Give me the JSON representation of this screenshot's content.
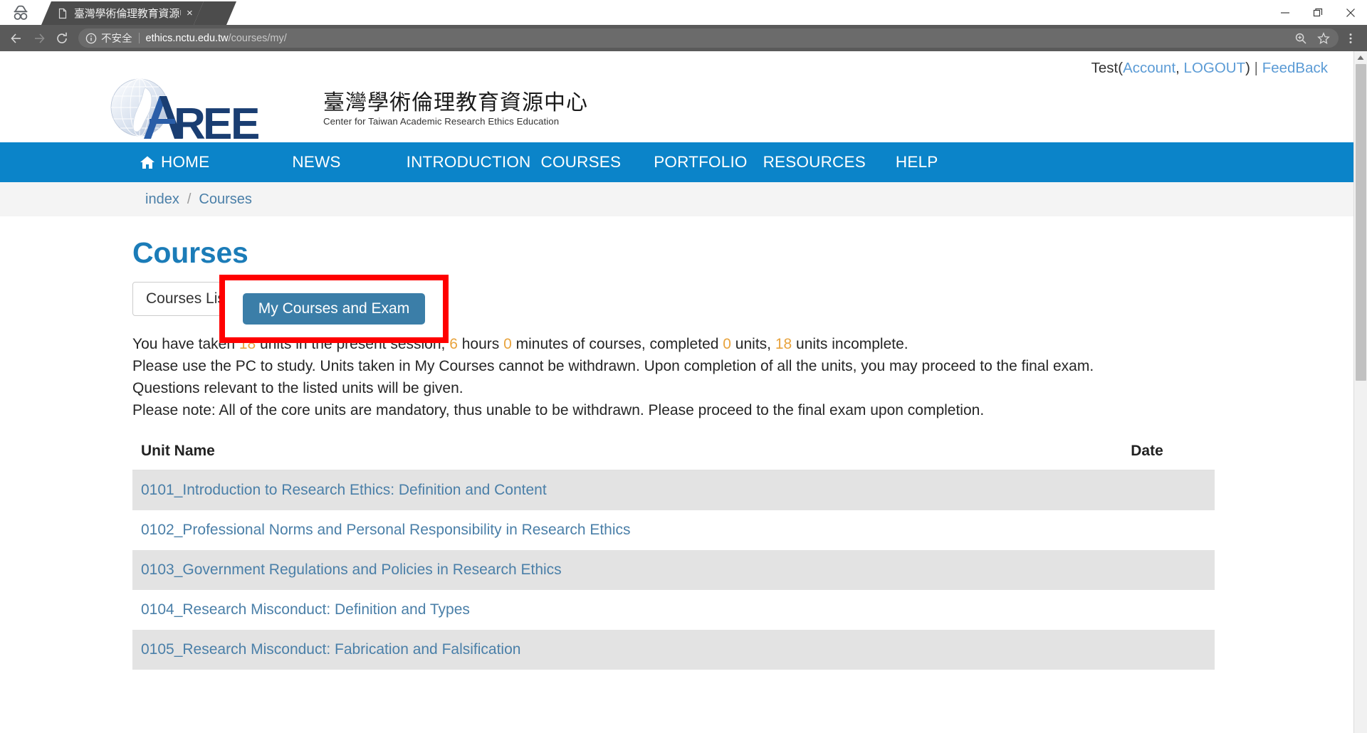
{
  "browser": {
    "incognito_icon": "incognito-icon",
    "tab": {
      "title": "臺灣學術倫理教育資源中",
      "favicon": "document-icon",
      "close": "×"
    },
    "nav": {
      "back": "back-arrow-icon",
      "forward": "forward-arrow-icon",
      "reload": "reload-icon"
    },
    "omnibox": {
      "info_icon": "info-circle-icon",
      "security_label": "不安全",
      "url_host": "ethics.nctu.edu.tw",
      "url_path": "/courses/my/",
      "zoom_icon": "zoom-search-icon",
      "bookmark_icon": "star-icon"
    },
    "menu_icon": "kebab-menu-icon",
    "window_controls": {
      "minimize": "minimize-icon",
      "maximize": "restore-icon",
      "close": "close-icon"
    }
  },
  "site": {
    "userbar": {
      "username": "Test",
      "open_paren": "(",
      "account_link": "Account",
      "comma": ", ",
      "logout_link": "LOGOUT",
      "close_paren": ")",
      "divider": "|",
      "feedback_link": "FeedBack"
    },
    "logo": {
      "wordmark": "AREE",
      "title_cn": "臺灣學術倫理教育資源中心",
      "subtitle_en": "Center for Taiwan Academic Research Ethics Education"
    },
    "nav_items": [
      {
        "label": "HOME",
        "icon": "home-icon"
      },
      {
        "label": "NEWS",
        "icon": ""
      },
      {
        "label": "INTRODUCTION",
        "icon": ""
      },
      {
        "label": "COURSES",
        "icon": ""
      },
      {
        "label": "PORTFOLIO",
        "icon": ""
      },
      {
        "label": "RESOURCES",
        "icon": ""
      },
      {
        "label": "HELP",
        "icon": ""
      }
    ],
    "breadcrumb": {
      "index": "index",
      "separator": "/",
      "current": "Courses"
    },
    "page_title": "Courses",
    "tabs": {
      "courses_list": "Courses List",
      "my_courses_and_exam": "My Courses and Exam"
    },
    "info": {
      "line1_a": "You have taken ",
      "units_taken": "18",
      "line1_b": " units in the present session, ",
      "hours": "6",
      "line1_c": " hours ",
      "minutes": "0",
      "line1_d": " minutes of courses, completed ",
      "completed": "0",
      "line1_e": " units, ",
      "incomplete": "18",
      "line1_f": " units incomplete.",
      "line2": "Please use the PC to study. Units taken in My Courses cannot be withdrawn. Upon completion of all the units, you may proceed to the final exam.",
      "line3": "Questions relevant to the listed units will be given.",
      "line4": "Please note: All of the core units are mandatory, thus unable to be withdrawn. Please proceed to the final exam upon completion."
    },
    "table": {
      "headers": {
        "unit_name": "Unit Name",
        "date": "Date"
      },
      "rows": [
        {
          "unit": "0101_Introduction to Research Ethics: Definition and Content",
          "date": ""
        },
        {
          "unit": "0102_Professional Norms and Personal Responsibility in Research Ethics",
          "date": ""
        },
        {
          "unit": "0103_Government Regulations and Policies in Research Ethics",
          "date": ""
        },
        {
          "unit": "0104_Research Misconduct: Definition and Types",
          "date": ""
        },
        {
          "unit": "0105_Research Misconduct: Fabrication and Falsification",
          "date": ""
        }
      ]
    },
    "colors": {
      "navbar_blue": "#0b84c9",
      "link_blue": "#4a7fa8",
      "title_blue": "#1b7cb8",
      "active_button": "#3b7ea8",
      "number_orange": "#e8a33d",
      "highlight_red": "#ff0000"
    }
  }
}
